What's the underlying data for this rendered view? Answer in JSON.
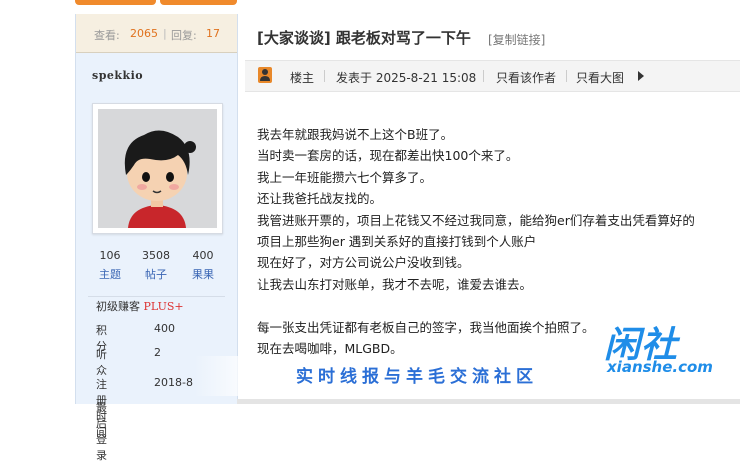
{
  "thread_stats": {
    "views_label": "查看:",
    "views": "2065",
    "replies_label": "回复:",
    "replies": "17"
  },
  "author": {
    "username": "spekkio",
    "topics": "106",
    "topics_label": "主题",
    "posts": "3508",
    "posts_label": "帖子",
    "fruit": "400",
    "fruit_label": "果果",
    "group": "初级赚客",
    "group_badge": "PLUS+",
    "points_label": "积分",
    "points": "400",
    "listeners_label": "听众",
    "listeners": "2",
    "reg_label": "注册时间",
    "reg_value": "2018-8",
    "last_label": "最后登录"
  },
  "thread": {
    "title": "[大家谈谈] 跟老板对骂了一下午",
    "copy_link": "[复制链接]"
  },
  "post_bar": {
    "floor": "楼主",
    "posted": "发表于 2025-8-21 15:08",
    "author_only": "只看该作者",
    "big_image": "只看大图"
  },
  "post_lines": [
    "我去年就跟我妈说不上这个B班了。",
    "当时卖一套房的话，现在都差出快100个来了。",
    "我上一年班能攒六七个算多了。",
    "还让我爸托战友找的。",
    "我管进账开票的，项目上花钱又不经过我同意，能给狗er们存着支出凭看算好的",
    "项目上那些狗er 遇到关系好的直接打钱到个人账户",
    "现在好了，对方公司说公户没收到钱。",
    "让我去山东打对账单，我才不去呢，谁爱去谁去。",
    "",
    "每一张支出凭证都有老板自己的签字，我当他面挨个拍照了。",
    "现在去喝咖啡，MLGBD。"
  ],
  "watermark": {
    "slogan": "实时线报与羊毛交流社区",
    "logo": "闲社",
    "domain": "xianshe.com"
  },
  "colors": {
    "accent": "#f08a2c",
    "sidebar_bg": "#eaf2fc",
    "link": "#3b66b4",
    "watermark": "#1f8de8"
  }
}
